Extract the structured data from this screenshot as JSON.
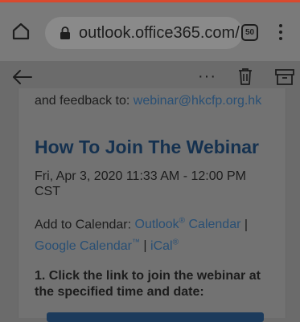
{
  "browser": {
    "url": "outlook.office365.com/",
    "tab_count": "50"
  },
  "email_toolbar": {
    "more_label": "···"
  },
  "email": {
    "feedback_prefix": "and feedback to: ",
    "feedback_email": "webinar@hkcfp.org.hk",
    "heading": "How To Join The Webinar",
    "date_line": "Fri, Apr 3, 2020 11:33 AM - 12:00 PM CST",
    "calendar_prefix": "Add to Calendar: ",
    "outlook_link": "Outlook",
    "outlook_sup": "®",
    "outlook_suffix": " Calendar",
    "sep1": " | ",
    "google_link": "Google Calendar",
    "google_sup": "™",
    "sep2": " | ",
    "ical_link": "iCal",
    "ical_sup": "®",
    "step1": "1. Click the link to join the webinar at the specified time and date:"
  }
}
